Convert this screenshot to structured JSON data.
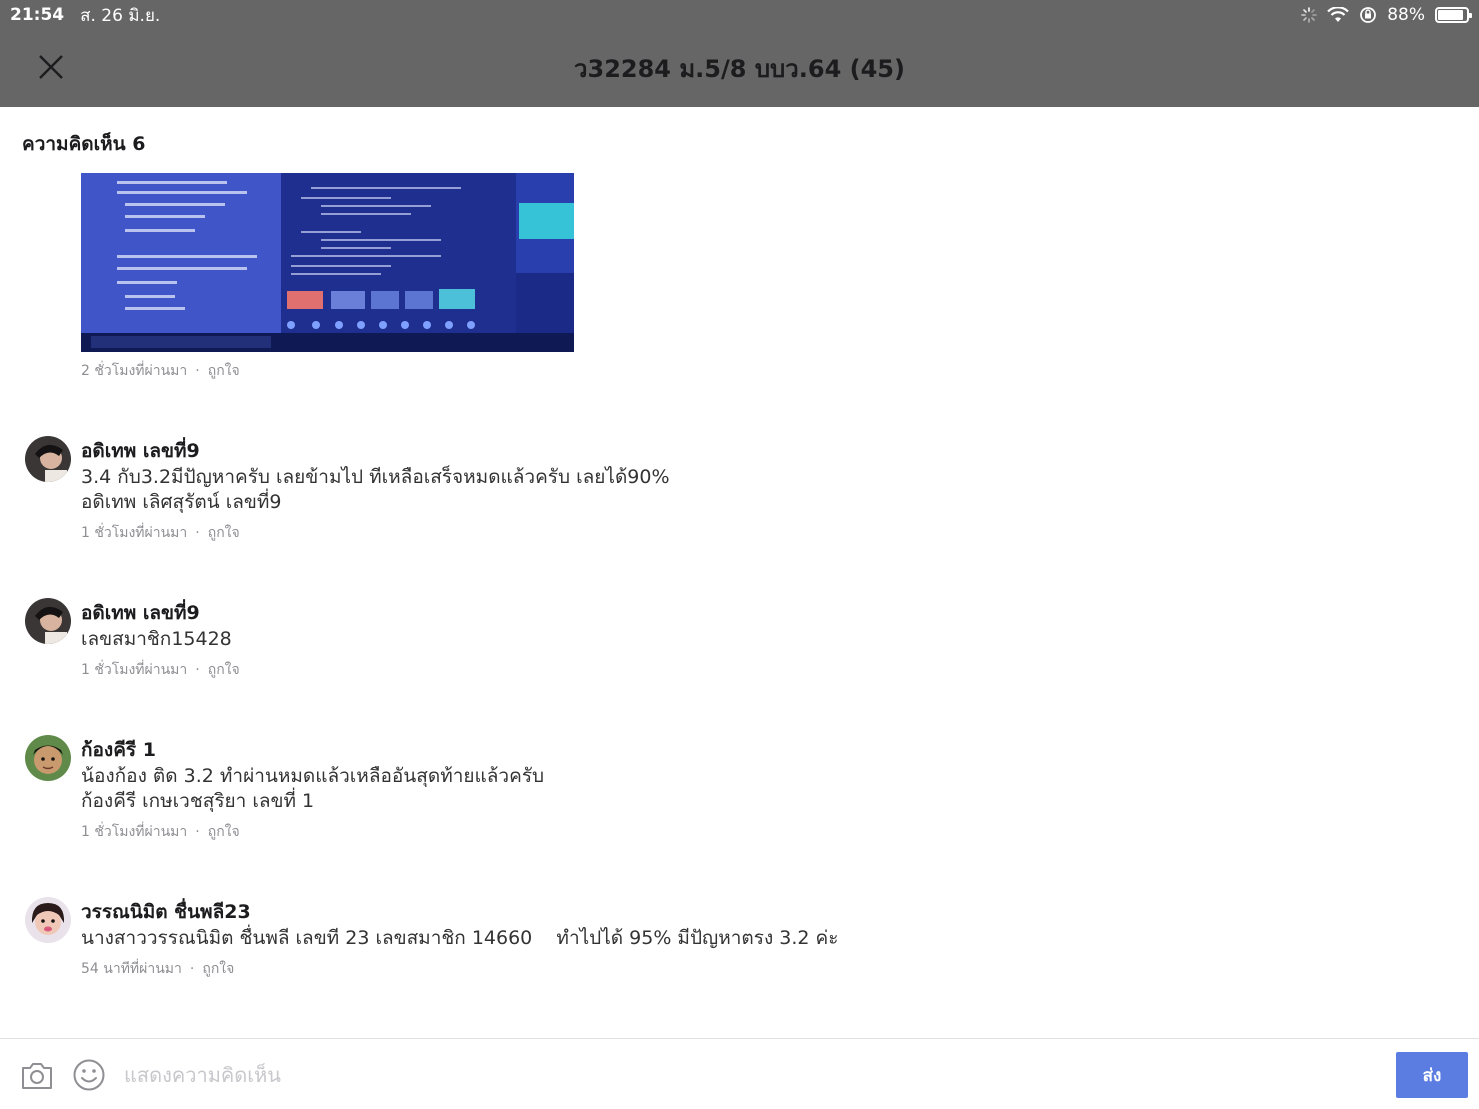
{
  "status": {
    "time": "21:54",
    "date": "ส. 26 มิ.ย.",
    "battery_text": "88%",
    "battery_level": 0.88
  },
  "nav": {
    "title": "ว32284 ม.5/8 บบว.64 (45)"
  },
  "comments_header": "ความคิดเห็น 6",
  "post": {
    "time": "2 ชั่วโมงที่ผ่านมา",
    "like": "ถูกใจ"
  },
  "comments": [
    {
      "author": "อดิเทพ เลขที่9",
      "lines": [
        "3.4 กับ3.2มีปัญหาครับ เลยข้ามไป ทีเหลือเสร็จหมดแล้วครับ เลยได้90%",
        "อดิเทพ เลิศสุรัตน์ เลขที่9"
      ],
      "time": "1 ชั่วโมงที่ผ่านมา",
      "like": "ถูกใจ"
    },
    {
      "author": "อดิเทพ เลขที่9",
      "lines": [
        "เลขสมาชิก15428"
      ],
      "time": "1 ชั่วโมงที่ผ่านมา",
      "like": "ถูกใจ"
    },
    {
      "author": "ก้องคีรี 1",
      "lines": [
        "น้องก้อง ติด 3.2 ทำผ่านหมดแล้วเหลืออันสุดท้ายแล้วครับ",
        "ก้องคีรี เกษเวชสุริยา เลขที่ 1"
      ],
      "time": "1 ชั่วโมงที่ผ่านมา",
      "like": "ถูกใจ"
    },
    {
      "author": "วรรณนิมิต ชื่นพลี23",
      "lines": [
        "นางสาววรรณนิมิต ชื่นพลี เลขที 23 เลขสมาชิก 14660    ทำไปได้ 95% มีปัญหาตรง 3.2 ค่ะ"
      ],
      "time": "54 นาทีที่ผ่านมา",
      "like": "ถูกใจ"
    }
  ],
  "composer": {
    "placeholder": "แสดงความคิดเห็น",
    "send_label": "ส่ง"
  }
}
